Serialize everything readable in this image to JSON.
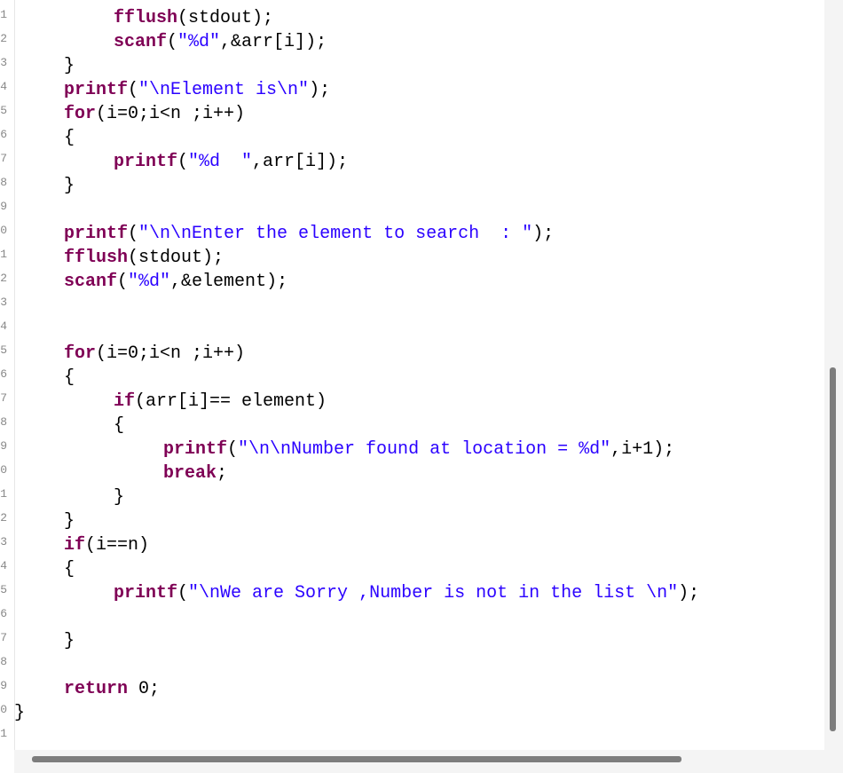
{
  "editor": {
    "line_number_fragments": [
      "1",
      "2",
      "3",
      "4",
      "5",
      "6",
      "7",
      "8",
      "9",
      "0",
      "1",
      "2",
      "3",
      "4",
      "5",
      "6",
      "7",
      "8",
      "9",
      "0",
      "1",
      "2",
      "3",
      "4",
      "5",
      "6",
      "7",
      "8",
      "9",
      "0",
      "1"
    ],
    "lines": [
      {
        "segments": [
          {
            "t": "fn",
            "v": "fflush"
          },
          {
            "t": "txt",
            "v": "(stdout);"
          }
        ]
      },
      {
        "segments": [
          {
            "t": "fn",
            "v": "scanf"
          },
          {
            "t": "txt",
            "v": "("
          },
          {
            "t": "str",
            "v": "\"%d\""
          },
          {
            "t": "txt",
            "v": ",&arr[i]);"
          }
        ]
      },
      {
        "segments": [
          {
            "t": "txt",
            "v": "}"
          }
        ]
      },
      {
        "segments": [
          {
            "t": "fn",
            "v": "printf"
          },
          {
            "t": "txt",
            "v": "("
          },
          {
            "t": "str",
            "v": "\"\\nElement is\\n\""
          },
          {
            "t": "txt",
            "v": ");"
          }
        ]
      },
      {
        "segments": [
          {
            "t": "kw",
            "v": "for"
          },
          {
            "t": "txt",
            "v": "(i=0;i<n ;i++)"
          }
        ]
      },
      {
        "segments": [
          {
            "t": "txt",
            "v": "{"
          }
        ]
      },
      {
        "segments": [
          {
            "t": "fn",
            "v": "printf"
          },
          {
            "t": "txt",
            "v": "("
          },
          {
            "t": "str",
            "v": "\"%d  \""
          },
          {
            "t": "txt",
            "v": ",arr[i]);"
          }
        ]
      },
      {
        "segments": [
          {
            "t": "txt",
            "v": "}"
          }
        ]
      },
      {
        "segments": []
      },
      {
        "segments": [
          {
            "t": "fn",
            "v": "printf"
          },
          {
            "t": "txt",
            "v": "("
          },
          {
            "t": "str",
            "v": "\"\\n\\nEnter the element to search  : \""
          },
          {
            "t": "txt",
            "v": ");"
          }
        ]
      },
      {
        "segments": [
          {
            "t": "fn",
            "v": "fflush"
          },
          {
            "t": "txt",
            "v": "(stdout);"
          }
        ]
      },
      {
        "segments": [
          {
            "t": "fn",
            "v": "scanf"
          },
          {
            "t": "txt",
            "v": "("
          },
          {
            "t": "str",
            "v": "\"%d\""
          },
          {
            "t": "txt",
            "v": ",&element);"
          }
        ]
      },
      {
        "segments": []
      },
      {
        "segments": []
      },
      {
        "segments": [
          {
            "t": "kw",
            "v": "for"
          },
          {
            "t": "txt",
            "v": "(i=0;i<n ;i++)"
          }
        ]
      },
      {
        "segments": [
          {
            "t": "txt",
            "v": "{"
          }
        ]
      },
      {
        "segments": [
          {
            "t": "kw",
            "v": "if"
          },
          {
            "t": "txt",
            "v": "(arr[i]== element)"
          }
        ]
      },
      {
        "segments": [
          {
            "t": "txt",
            "v": "{"
          }
        ]
      },
      {
        "segments": [
          {
            "t": "fn",
            "v": "printf"
          },
          {
            "t": "txt",
            "v": "("
          },
          {
            "t": "str",
            "v": "\"\\n\\nNumber found at location = %d\""
          },
          {
            "t": "txt",
            "v": ",i+1);"
          }
        ]
      },
      {
        "segments": [
          {
            "t": "kw",
            "v": "break"
          },
          {
            "t": "txt",
            "v": ";"
          }
        ]
      },
      {
        "segments": [
          {
            "t": "txt",
            "v": "}"
          }
        ]
      },
      {
        "segments": [
          {
            "t": "txt",
            "v": "}"
          }
        ]
      },
      {
        "segments": [
          {
            "t": "kw",
            "v": "if"
          },
          {
            "t": "txt",
            "v": "(i==n)"
          }
        ]
      },
      {
        "segments": [
          {
            "t": "txt",
            "v": "{"
          }
        ]
      },
      {
        "segments": [
          {
            "t": "fn",
            "v": "printf"
          },
          {
            "t": "txt",
            "v": "("
          },
          {
            "t": "str",
            "v": "\"\\nWe are Sorry ,Number is not in the list \\n\""
          },
          {
            "t": "txt",
            "v": ");"
          }
        ]
      },
      {
        "segments": []
      },
      {
        "segments": [
          {
            "t": "txt",
            "v": "}"
          }
        ]
      },
      {
        "segments": []
      },
      {
        "segments": [
          {
            "t": "kw",
            "v": "return"
          },
          {
            "t": "txt",
            "v": " 0;"
          }
        ]
      },
      {
        "segments": [
          {
            "t": "txt",
            "v": "}"
          }
        ]
      },
      {
        "segments": []
      }
    ]
  },
  "colors": {
    "keyword": "#7f0055",
    "string": "#2a00ff",
    "text": "#000000",
    "scrollbar_thumb": "#7d7d7d",
    "scrollbar_track": "#f4f4f4"
  }
}
